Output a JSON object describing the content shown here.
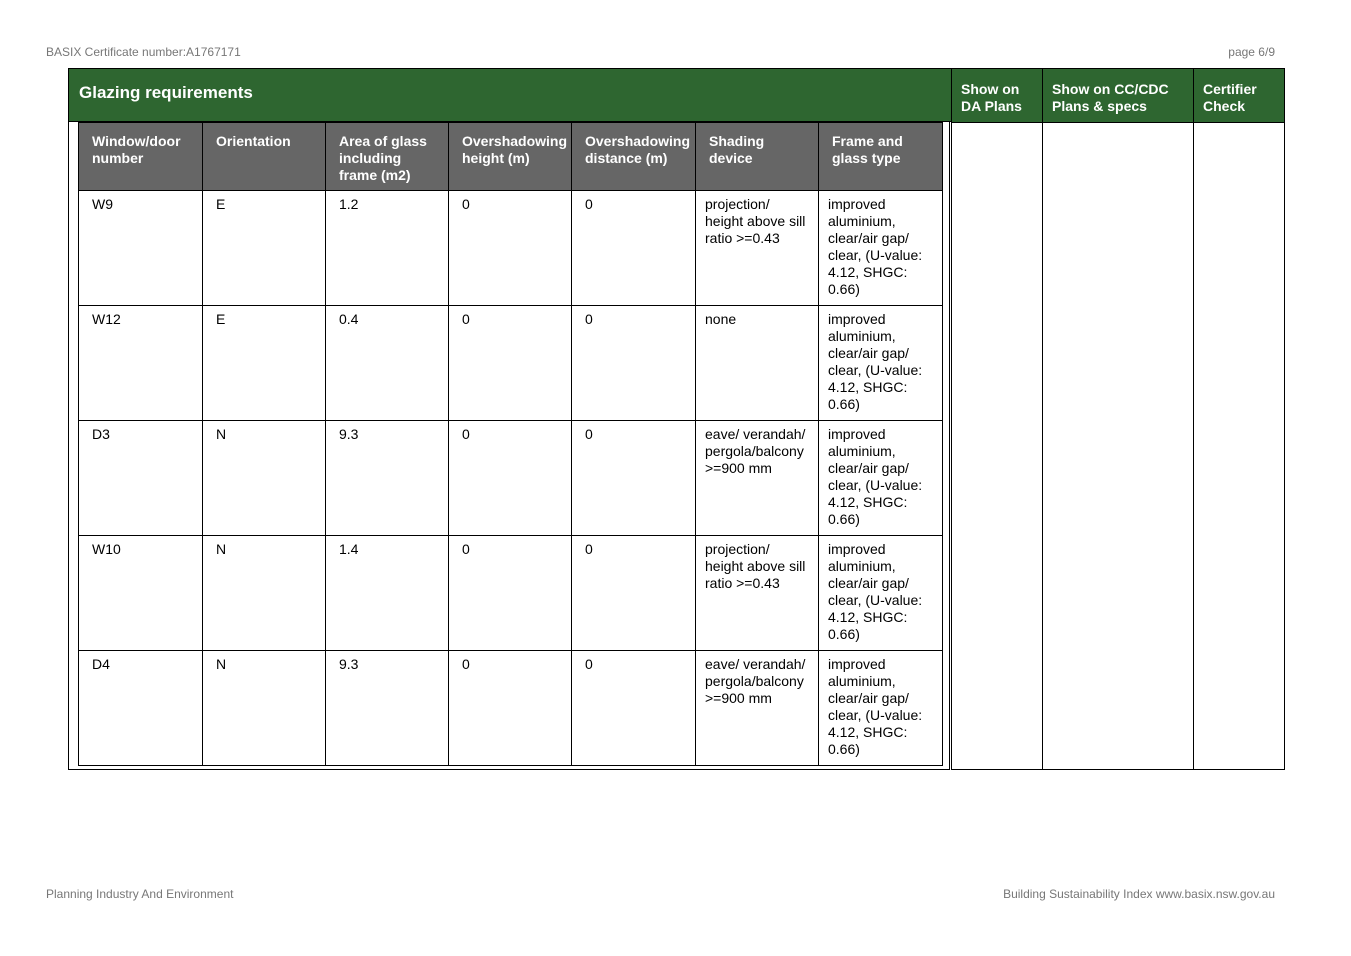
{
  "header": {
    "certificate": "BASIX Certificate number:A1767171",
    "page": "page 6/9"
  },
  "section": {
    "title": "Glazing requirements",
    "side_columns": [
      "Show on DA Plans",
      "Show on CC/CDC Plans & specs",
      "Certifier Check"
    ]
  },
  "table": {
    "columns": [
      "Window/door number",
      "Orientation",
      "Area of glass including frame (m2)",
      "Overshadowing height (m)",
      "Overshadowing distance (m)",
      "Shading device",
      "Frame and glass type"
    ],
    "rows": [
      [
        "W9",
        "E",
        "1.2",
        "0",
        "0",
        "projection/ height above sill ratio >=0.43",
        "improved aluminium, clear/air gap/ clear, (U-value: 4.12, SHGC: 0.66)"
      ],
      [
        "W12",
        "E",
        "0.4",
        "0",
        "0",
        "none",
        "improved aluminium, clear/air gap/ clear, (U-value: 4.12, SHGC: 0.66)"
      ],
      [
        "D3",
        "N",
        "9.3",
        "0",
        "0",
        "eave/ verandah/ pergola/balcony >=900 mm",
        "improved aluminium, clear/air gap/ clear, (U-value: 4.12, SHGC: 0.66)"
      ],
      [
        "W10",
        "N",
        "1.4",
        "0",
        "0",
        "projection/ height above sill ratio >=0.43",
        "improved aluminium, clear/air gap/ clear, (U-value: 4.12, SHGC: 0.66)"
      ],
      [
        "D4",
        "N",
        "9.3",
        "0",
        "0",
        "eave/ verandah/ pergola/balcony >=900 mm",
        "improved aluminium, clear/air gap/ clear, (U-value: 4.12, SHGC: 0.66)"
      ]
    ]
  },
  "footer": {
    "left": "Planning Industry And Environment",
    "right": "Building Sustainability Index www.basix.nsw.gov.au"
  },
  "colors": {
    "title_green": "#2e6630",
    "header_grey": "#666666"
  }
}
